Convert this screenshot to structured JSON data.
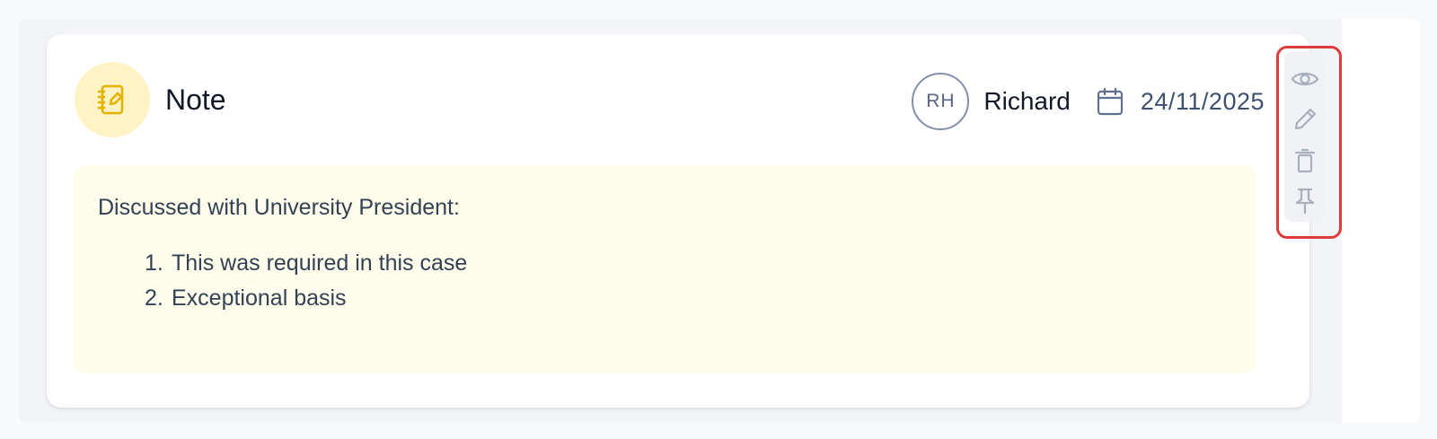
{
  "note": {
    "type_label": "Note",
    "icon": "note-edit-icon",
    "author_initials": "RH",
    "author_name": "Richard",
    "date_icon": "calendar-icon",
    "date": "24/11/2025",
    "body_intro": "Discussed with University President:",
    "body_items": [
      {
        "number": "1.",
        "text": "This was required in this case"
      },
      {
        "number": "2.",
        "text": "Exceptional basis"
      }
    ]
  },
  "actions": [
    {
      "name": "view",
      "icon": "eye-icon"
    },
    {
      "name": "edit",
      "icon": "pencil-icon"
    },
    {
      "name": "delete",
      "icon": "trash-icon"
    },
    {
      "name": "pin",
      "icon": "pin-icon"
    }
  ],
  "colors": {
    "note_icon_bg": "#fdf3c4",
    "note_icon": "#e5b200",
    "note_body_bg": "#fefdec",
    "action_icon": "#a8afbd",
    "highlight": "#de3b3b",
    "date_text": "#3d5070"
  }
}
